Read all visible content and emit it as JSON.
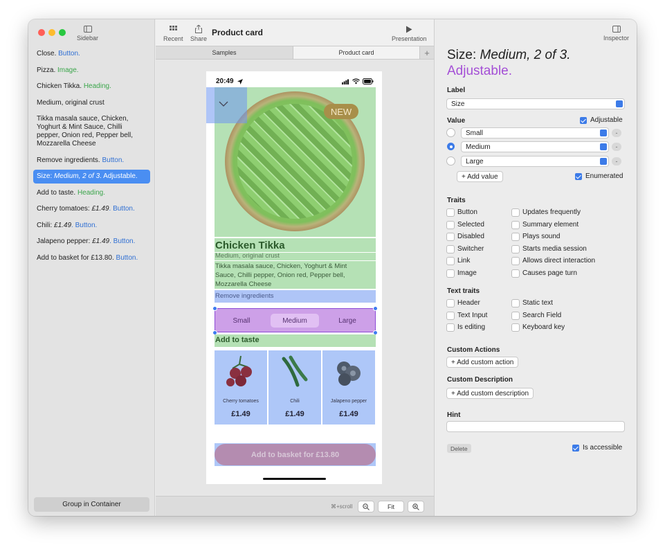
{
  "toolbar": {
    "sidebar_label": "Sidebar",
    "recent_label": "Recent",
    "share_label": "Share",
    "document_title": "Product card",
    "presentation_label": "Presentation",
    "inspector_label": "Inspector"
  },
  "sidebar": {
    "items": [
      {
        "text": "Close.",
        "role": "Button."
      },
      {
        "text": "Pizza.",
        "role": "Image."
      },
      {
        "text": "Chicken Tikka.",
        "role": "Heading."
      },
      {
        "text": "Medium, original crust",
        "role": ""
      },
      {
        "text": "Tikka masala sauce, Chicken, Yoghurt & Mint Sauce, Chilli pepper, Onion red, Pepper bell, Mozzarella Cheese",
        "role": ""
      },
      {
        "text": "Remove ingredients.",
        "role": "Button."
      },
      {
        "text": "Size: ",
        "italic": "Medium, 2 of 3",
        "role": ". Adjustable."
      },
      {
        "text": "Add to taste.",
        "role": "Heading."
      },
      {
        "text": "Cherry tomatoes: ",
        "italic": "£1.49",
        "role": ". Button."
      },
      {
        "text": "Chili: ",
        "italic": "£1.49",
        "role": ". Button."
      },
      {
        "text": "Jalapeno pepper: ",
        "italic": "£1.49",
        "role": ". Button."
      },
      {
        "text": "Add to basket for £13.80.",
        "role": "Button."
      }
    ],
    "group_button": "Group in Container"
  },
  "tabs": {
    "samples": "Samples",
    "product_card": "Product card",
    "plus": "+"
  },
  "canvas_footer": {
    "scroll_hint": "⌘+scroll",
    "fit_label": "Fit"
  },
  "phone": {
    "time": "20:49",
    "badge": "NEW",
    "title": "Chicken Tikka",
    "subtitle": "Medium, original crust",
    "description": "Tikka masala sauce, Chicken, Yoghurt & Mint Sauce, Chilli pepper, Onion red, Pepper bell, Mozzarella Cheese",
    "remove_ingredients": "Remove ingredients",
    "sizes": [
      "Small",
      "Medium",
      "Large"
    ],
    "add_to_taste": "Add to taste",
    "toppings": [
      {
        "name": "Cherry tomatoes",
        "price": "£1.49"
      },
      {
        "name": "Chili",
        "price": "£1.49"
      },
      {
        "name": "Jalapeno pepper",
        "price": "£1.49"
      }
    ],
    "basket": "Add to basket for £13.80"
  },
  "inspector": {
    "title_prefix": "Size: ",
    "title_value": "Medium, 2 of 3.",
    "title_trait": "Adjustable.",
    "label_section": "Label",
    "label_value": "Size",
    "value_section": "Value",
    "adjustable_label": "Adjustable",
    "values": [
      "Small",
      "Medium",
      "Large"
    ],
    "minus": "-",
    "add_value": "+ Add value",
    "enumerated_label": "Enumerated",
    "traits_section": "Traits",
    "traits_left": [
      "Button",
      "Selected",
      "Disabled",
      "Switcher",
      "Link",
      "Image"
    ],
    "traits_right": [
      "Updates frequently",
      "Summary element",
      "Plays sound",
      "Starts media session",
      "Allows direct interaction",
      "Causes page turn"
    ],
    "text_traits_section": "Text traits",
    "text_traits_left": [
      "Header",
      "Text Input",
      "Is editing"
    ],
    "text_traits_right": [
      "Static text",
      "Search Field",
      "Keyboard key"
    ],
    "custom_actions_section": "Custom Actions",
    "add_custom_action": "+ Add custom action",
    "custom_description_section": "Custom Description",
    "add_custom_description": "+ Add custom description",
    "hint_section": "Hint",
    "delete_label": "Delete",
    "is_accessible_label": "Is accessible"
  },
  "colors": {
    "accent": "#3c7be8",
    "button_role": "#2f6fd3",
    "heading_role": "#3aa54a",
    "adjustable_purple": "#a44fd6"
  }
}
